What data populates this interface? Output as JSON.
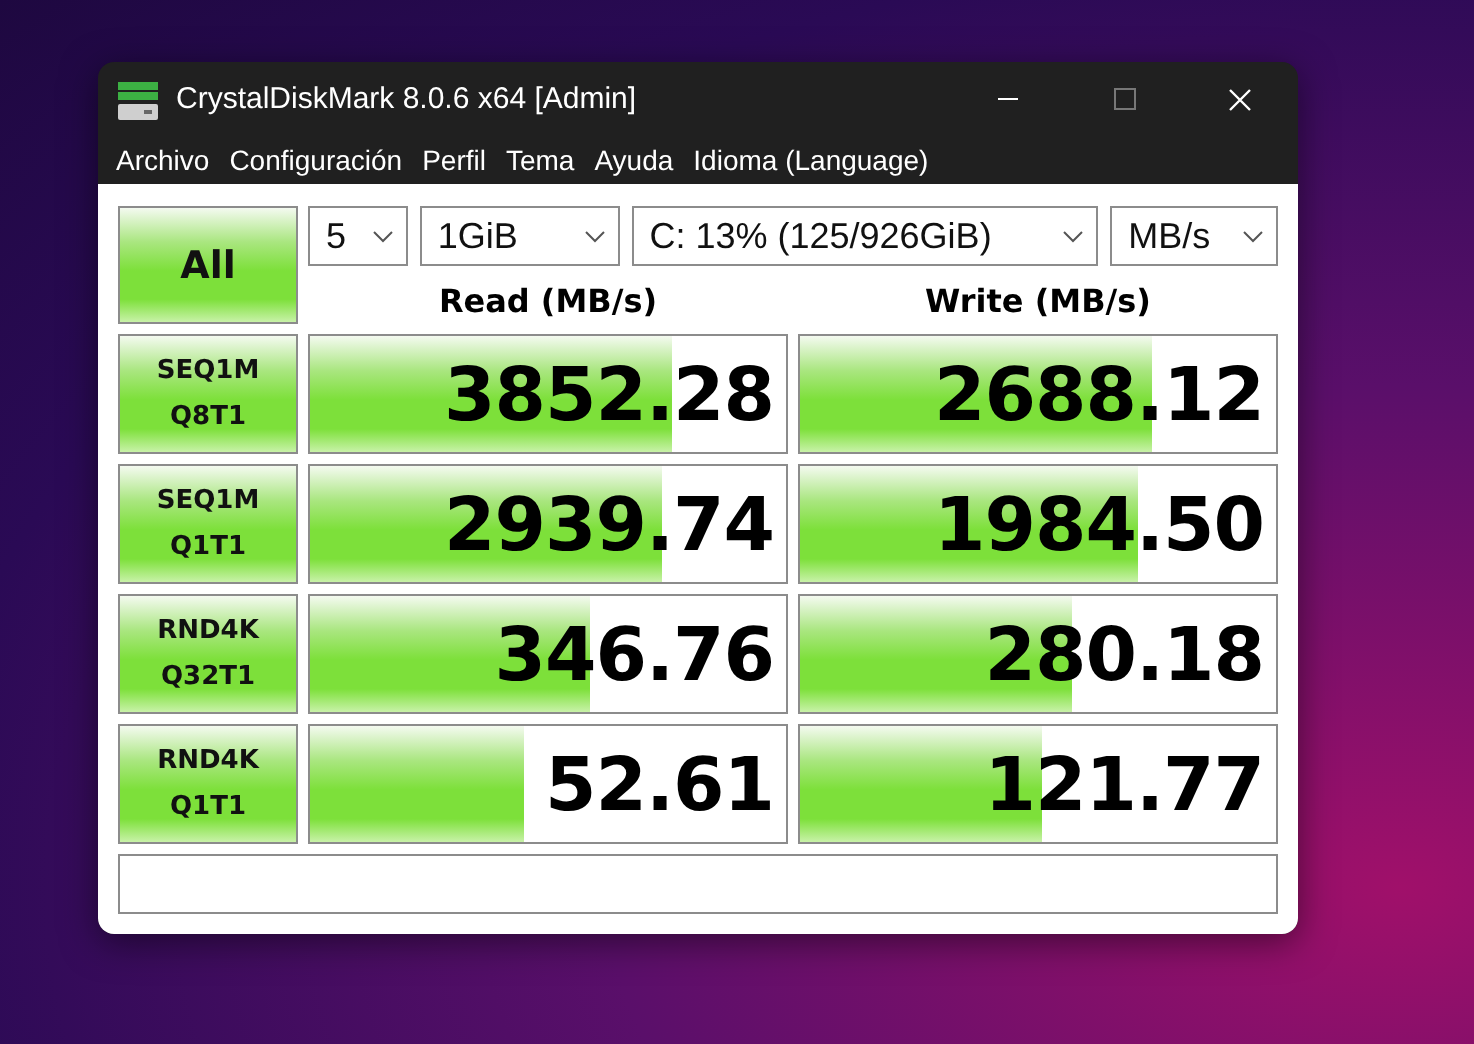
{
  "window": {
    "title": "CrystalDiskMark 8.0.6 x64 [Admin]"
  },
  "menu": [
    "Archivo",
    "Configuración",
    "Perfil",
    "Tema",
    "Ayuda",
    "Idioma (Language)"
  ],
  "all_button": "All",
  "selects": [
    {
      "value": "5"
    },
    {
      "value": "1GiB"
    },
    {
      "value": "C: 13% (125/926GiB)"
    },
    {
      "value": "MB/s"
    }
  ],
  "headers": [
    "Read (MB/s)",
    "Write (MB/s)"
  ],
  "tests": [
    {
      "name": "SEQ1M",
      "params": "Q8T1",
      "read": {
        "value": "3852.28",
        "level": 0.76
      },
      "write": {
        "value": "2688.12",
        "level": 0.74
      }
    },
    {
      "name": "SEQ1M",
      "params": "Q1T1",
      "read": {
        "value": "2939.74",
        "level": 0.74
      },
      "write": {
        "value": "1984.50",
        "level": 0.71
      }
    },
    {
      "name": "RND4K",
      "params": "Q32T1",
      "read": {
        "value": "346.76",
        "level": 0.59
      },
      "write": {
        "value": "280.18",
        "level": 0.57
      }
    },
    {
      "name": "RND4K",
      "params": "Q1T1",
      "read": {
        "value": "52.61",
        "level": 0.45
      },
      "write": {
        "value": "121.77",
        "level": 0.51
      }
    }
  ]
}
